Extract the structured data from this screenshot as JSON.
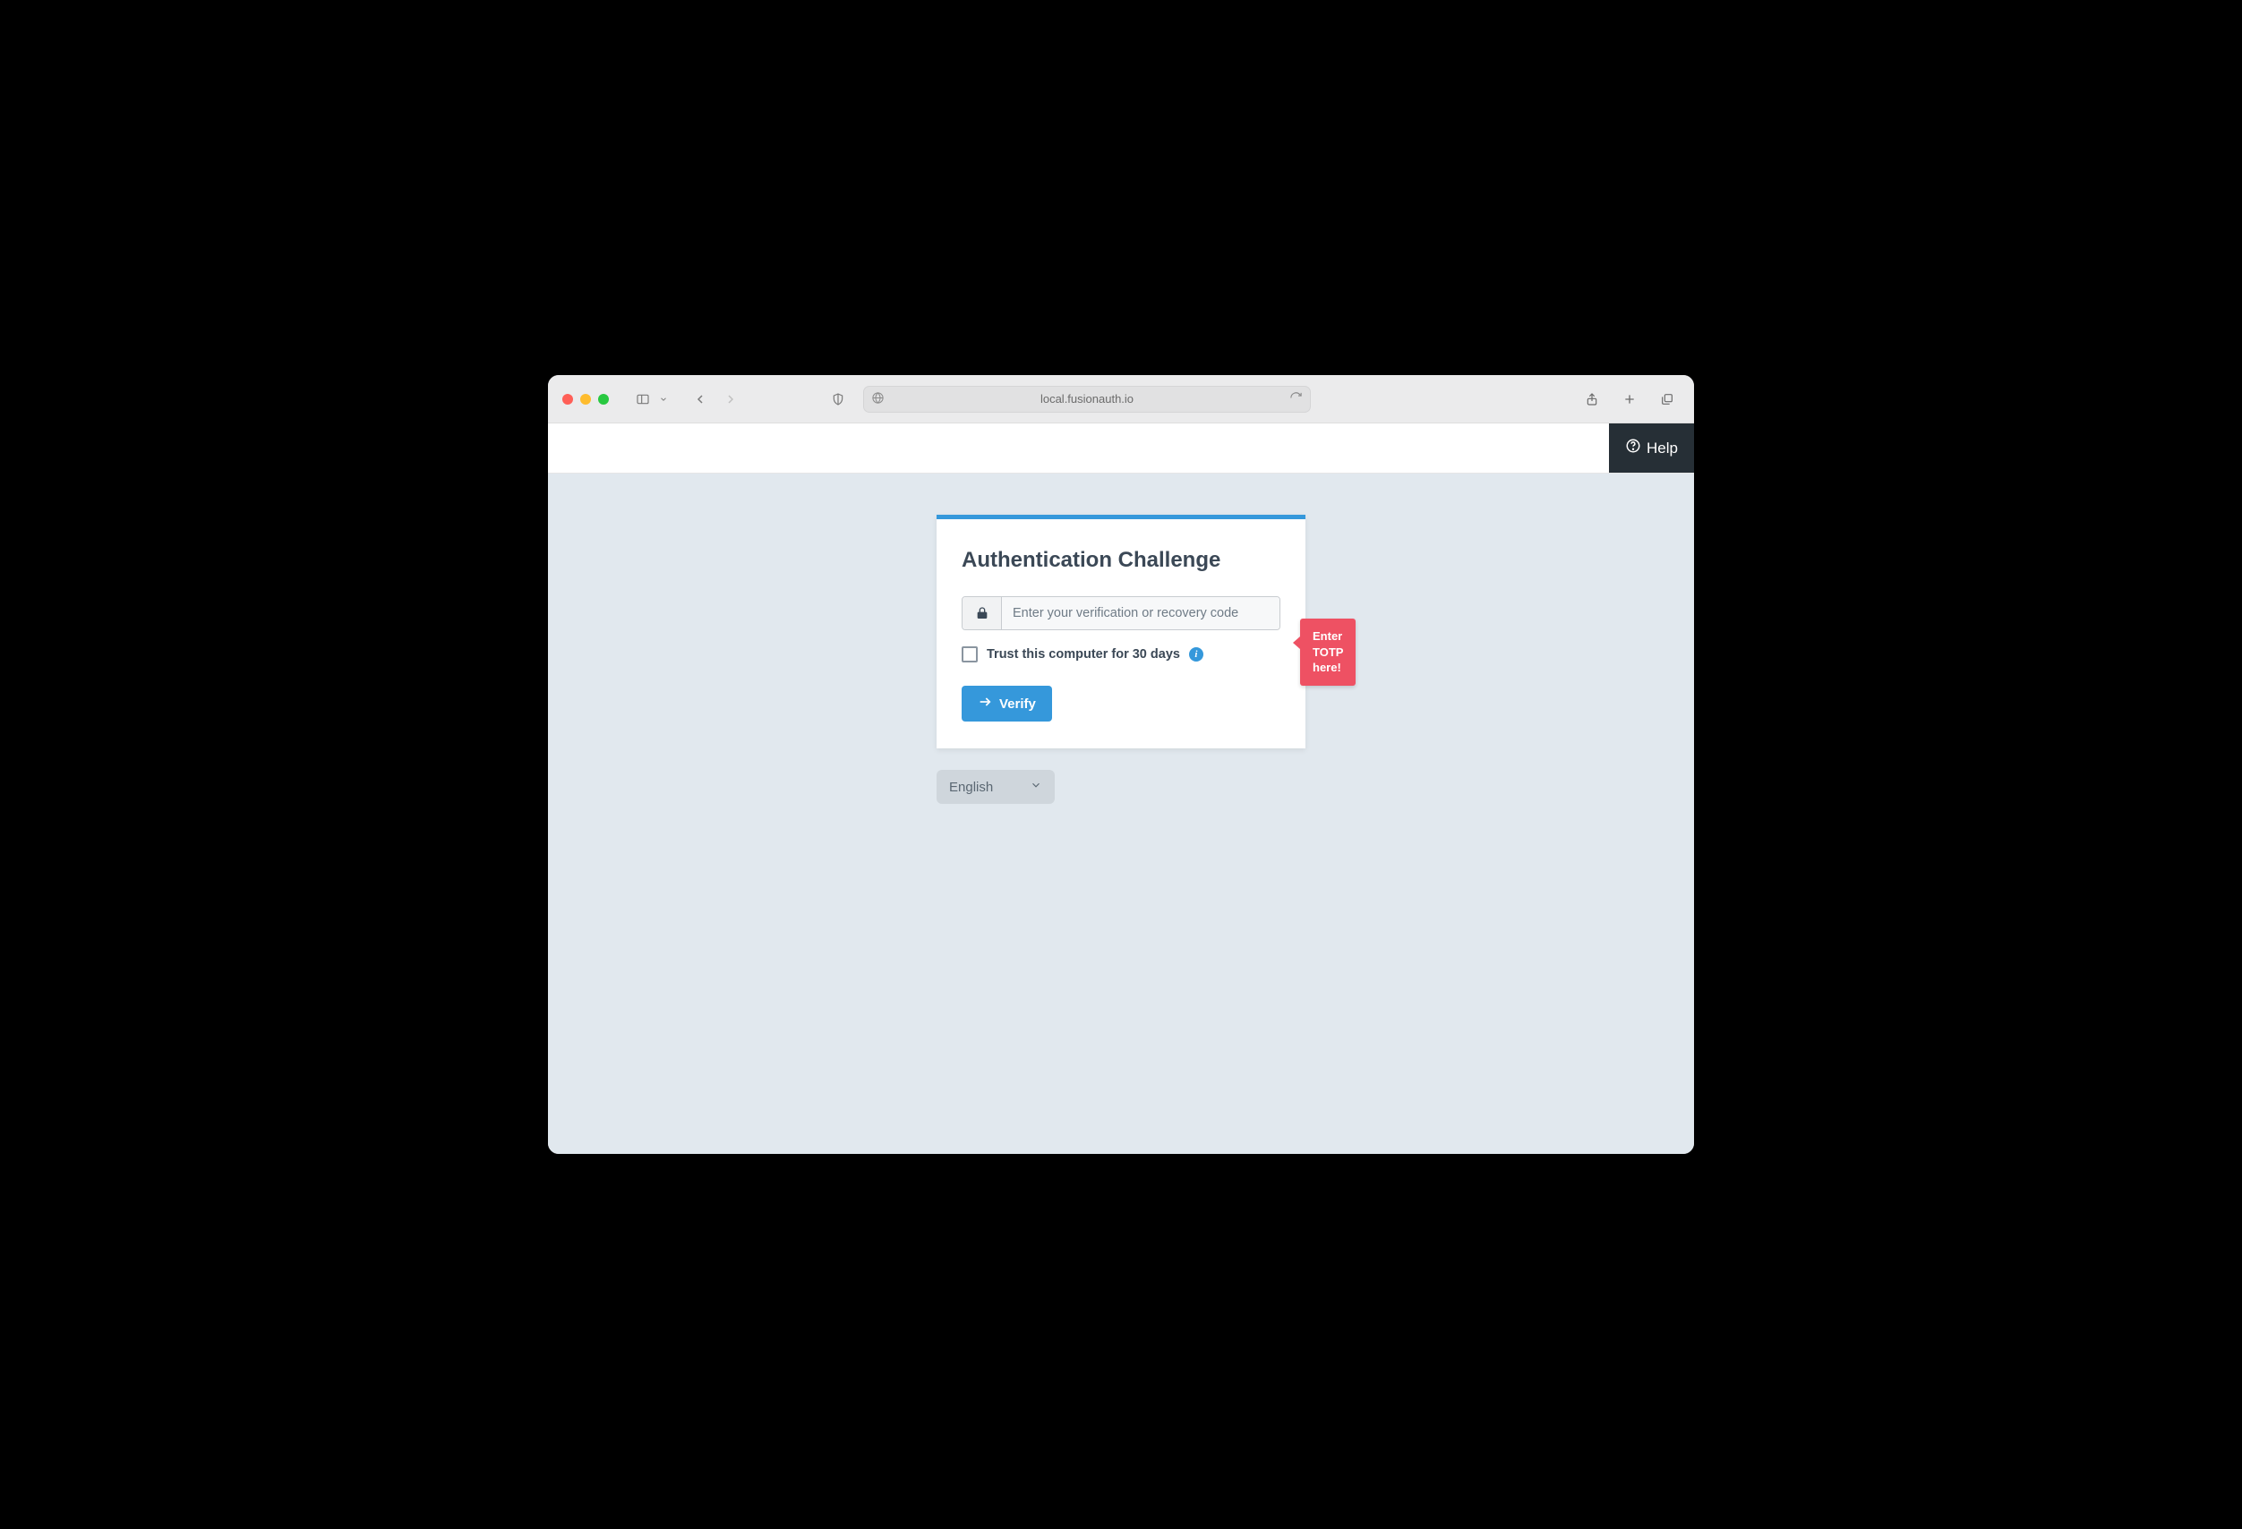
{
  "browser": {
    "address": "local.fusionauth.io"
  },
  "header": {
    "help_label": "Help"
  },
  "card": {
    "title": "Authentication Challenge",
    "code_placeholder": "Enter your verification or recovery code",
    "trust_label": "Trust this computer for 30 days",
    "verify_label": "Verify"
  },
  "callout": {
    "text": "Enter TOTP\nhere!"
  },
  "language": {
    "selected": "English"
  },
  "colors": {
    "accent": "#3598db",
    "callout": "#ee5163",
    "page_bg": "#e1e8ee",
    "text_dark": "#3b4856"
  }
}
